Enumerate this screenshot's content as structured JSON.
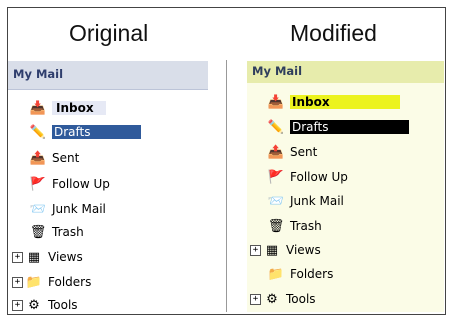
{
  "titles": {
    "original": "Original",
    "modified": "Modified"
  },
  "original": {
    "header": "My Mail",
    "items": [
      {
        "label": "Inbox"
      },
      {
        "label": "Drafts"
      },
      {
        "label": "Sent"
      },
      {
        "label": "Follow Up"
      },
      {
        "label": "Junk Mail"
      },
      {
        "label": "Trash"
      },
      {
        "label": "Views"
      },
      {
        "label": "Folders"
      },
      {
        "label": "Tools"
      }
    ]
  },
  "modified": {
    "header": "My Mail",
    "items": [
      {
        "label": "Inbox"
      },
      {
        "label": "Drafts"
      },
      {
        "label": "Sent"
      },
      {
        "label": "Follow Up"
      },
      {
        "label": "Junk Mail"
      },
      {
        "label": "Trash"
      },
      {
        "label": "Views"
      },
      {
        "label": "Folders"
      },
      {
        "label": "Tools"
      }
    ]
  },
  "icons": {
    "inbox": "inbox-tray-icon",
    "drafts": "pencil-icon",
    "sent": "sent-icon",
    "followup": "flag-icon",
    "junk": "junk-mail-icon",
    "trash": "trash-icon",
    "views": "views-table-icon",
    "folders": "folder-icon",
    "tools": "tools-gear-icon",
    "expander": "expand-plus-icon"
  },
  "colors": {
    "original_selection": "#2f5a9b",
    "modified_inbox_highlight": "#ecf31e",
    "modified_drafts_selection": "#000000",
    "original_header_bg": "#d9dee9",
    "modified_header_bg": "#e7ecac"
  }
}
